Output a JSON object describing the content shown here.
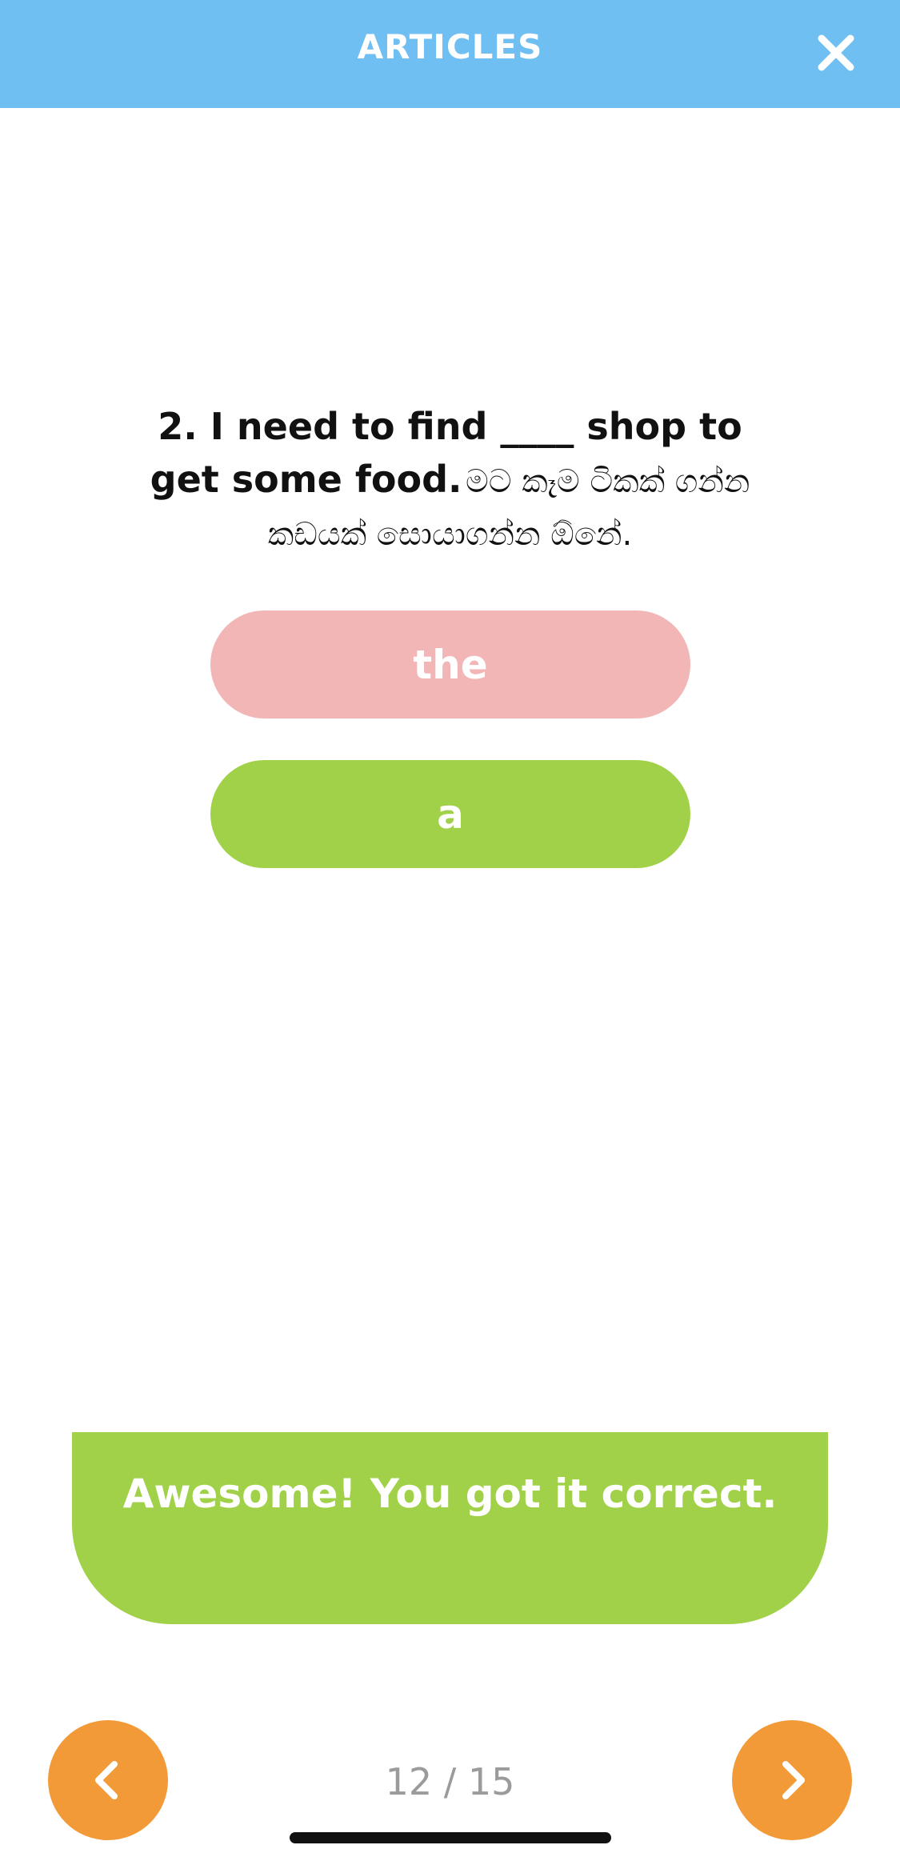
{
  "header": {
    "title": "ARTICLES",
    "close_icon": "close-icon",
    "background_color": "#70bff2"
  },
  "question": {
    "english": "2. I need to find ____ shop to get some food.",
    "sinhala": "මට කෑම ටිකක් ගන්න කඩයක් සොයාගන්න ඕනේ."
  },
  "answers": [
    {
      "label": "the",
      "state": "incorrect",
      "color": "#f2b6b6"
    },
    {
      "label": "a",
      "state": "correct",
      "color": "#a1d149"
    }
  ],
  "feedback": {
    "message": "Awesome! You got it correct.",
    "color": "#a1d149"
  },
  "navigation": {
    "prev_icon": "chevron-left-icon",
    "next_icon": "chevron-right-icon",
    "counter": "12 / 15",
    "button_color": "#f29a37"
  }
}
